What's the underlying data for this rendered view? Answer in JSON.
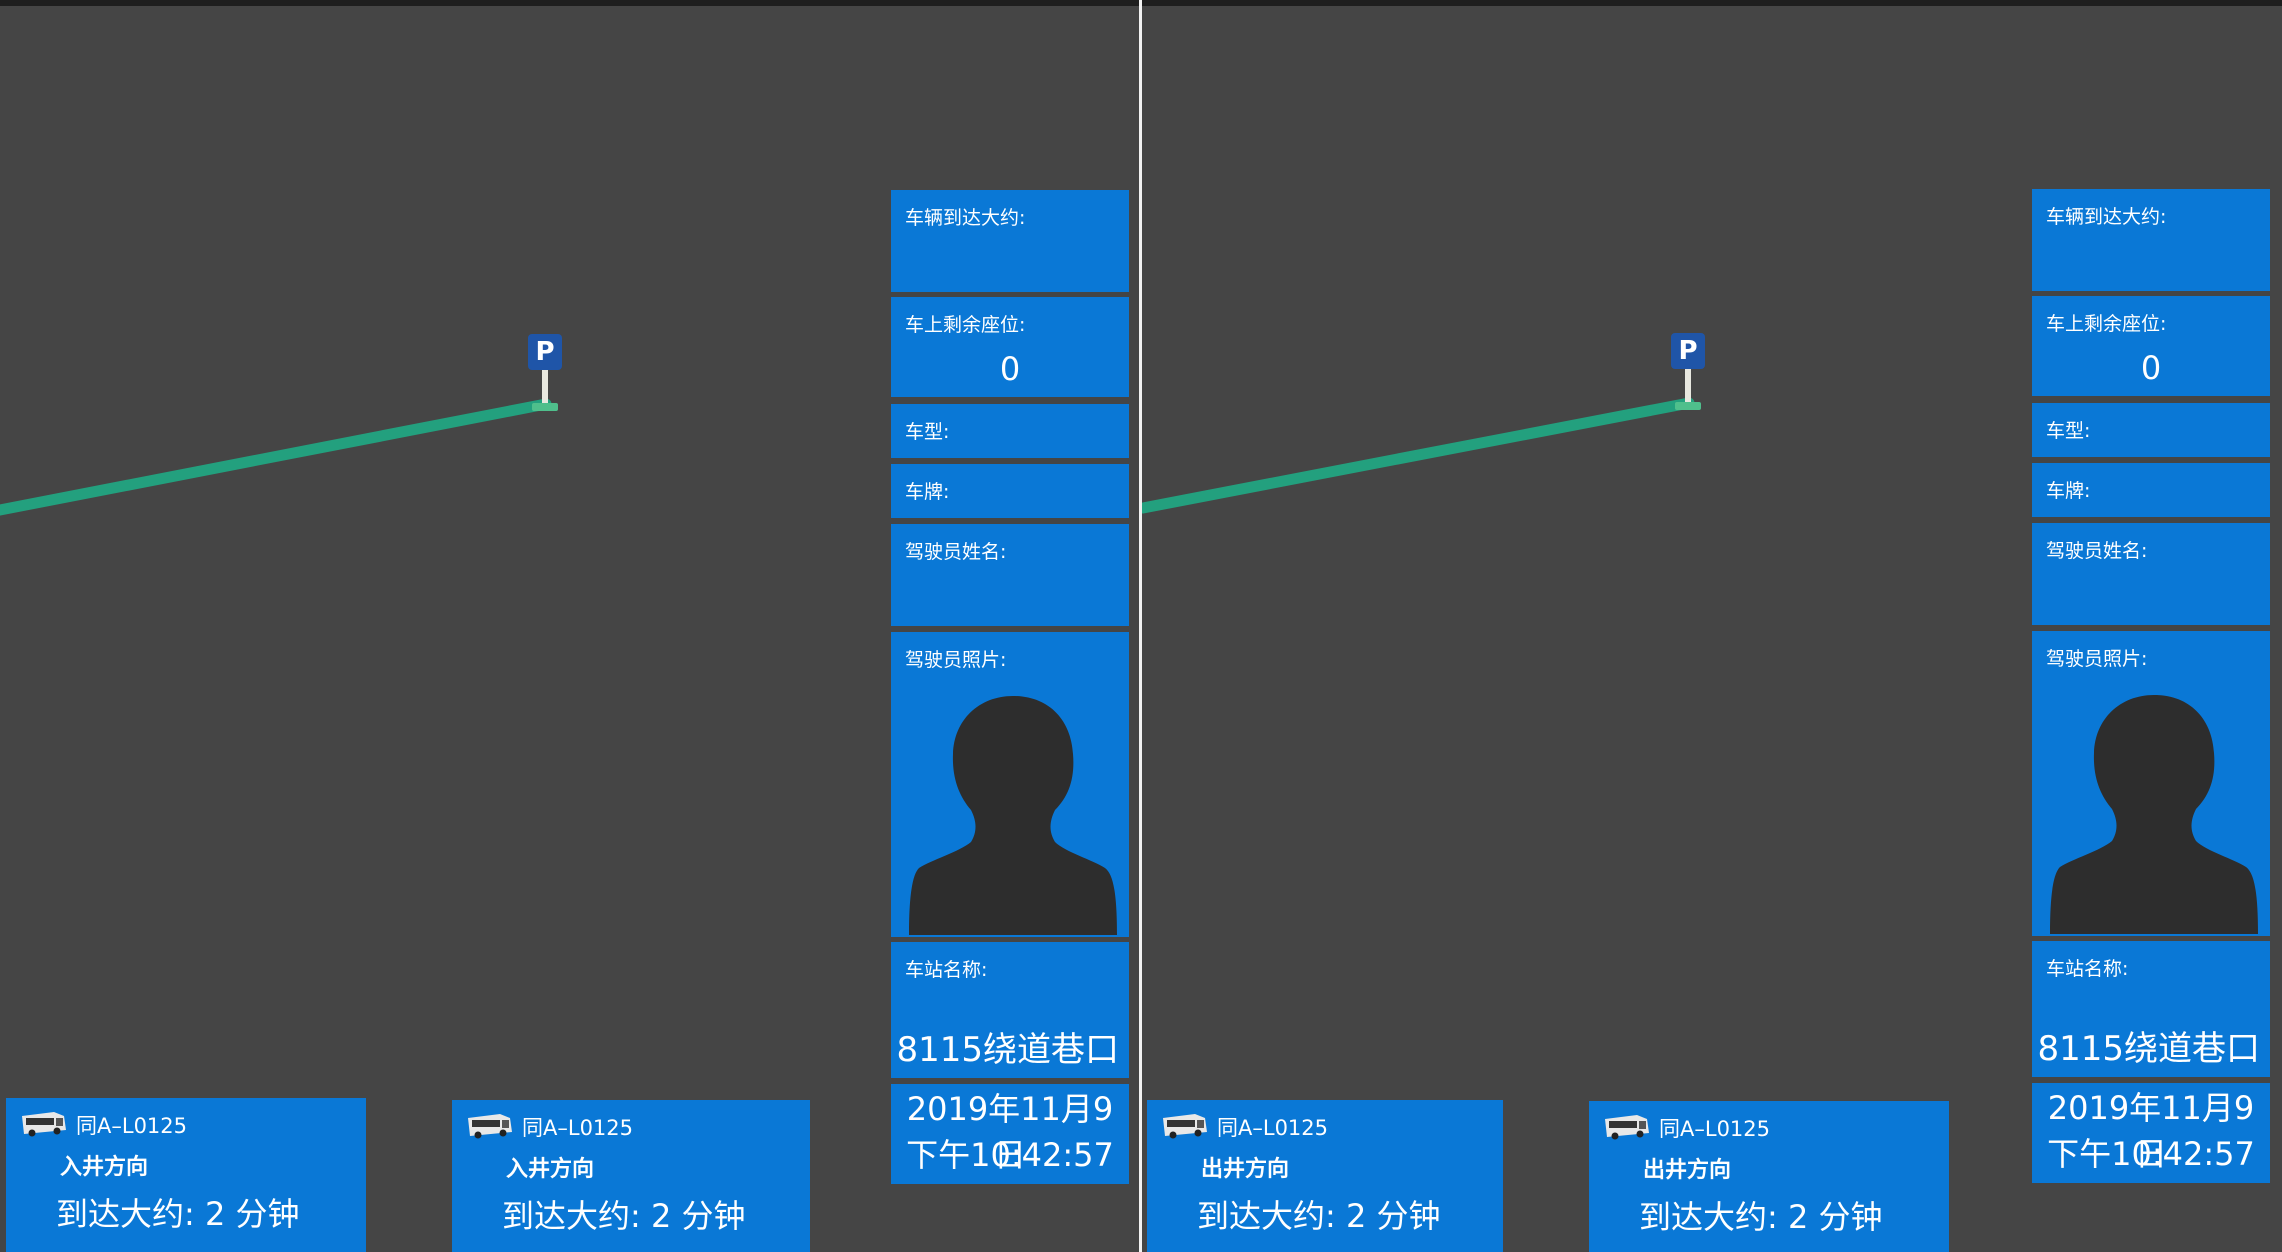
{
  "screens": [
    {
      "panel": {
        "arrival_label": "车辆到达大约:",
        "seats_label": "车上剩余座位:",
        "seats_value": "0",
        "model_label": "车型:",
        "plate_label": "车牌:",
        "driver_name_label": "驾驶员姓名:",
        "driver_photo_label": "驾驶员照片:",
        "station_label": "车站名称:",
        "station_name": "8115绕道巷口",
        "date": "2019年11月9日",
        "time": "下午10:42:57"
      },
      "map": {
        "marker_letter": "P"
      },
      "cards": [
        {
          "plate": "同A–L0125",
          "direction": "入井方向",
          "eta_label": "到达大约:",
          "eta_value": "2 分钟"
        },
        {
          "plate": "同A–L0125",
          "direction": "入井方向",
          "eta_label": "到达大约:",
          "eta_value": "2 分钟"
        }
      ]
    },
    {
      "panel": {
        "arrival_label": "车辆到达大约:",
        "seats_label": "车上剩余座位:",
        "seats_value": "0",
        "model_label": "车型:",
        "plate_label": "车牌:",
        "driver_name_label": "驾驶员姓名:",
        "driver_photo_label": "驾驶员照片:",
        "station_label": "车站名称:",
        "station_name": "8115绕道巷口",
        "date": "2019年11月9日",
        "time": "下午10:42:57"
      },
      "map": {
        "marker_letter": "P"
      },
      "cards": [
        {
          "plate": "同A–L0125",
          "direction": "出井方向",
          "eta_label": "到达大约:",
          "eta_value": "2 分钟"
        },
        {
          "plate": "同A–L0125",
          "direction": "出井方向",
          "eta_label": "到达大约:",
          "eta_value": "2 分钟"
        }
      ]
    }
  ],
  "colors": {
    "panel_bg": "#0a78d6",
    "route": "#23a07e",
    "background": "#454545"
  },
  "icons": [
    "parking-marker-icon",
    "driver-silhouette-icon",
    "bus-icon"
  ]
}
